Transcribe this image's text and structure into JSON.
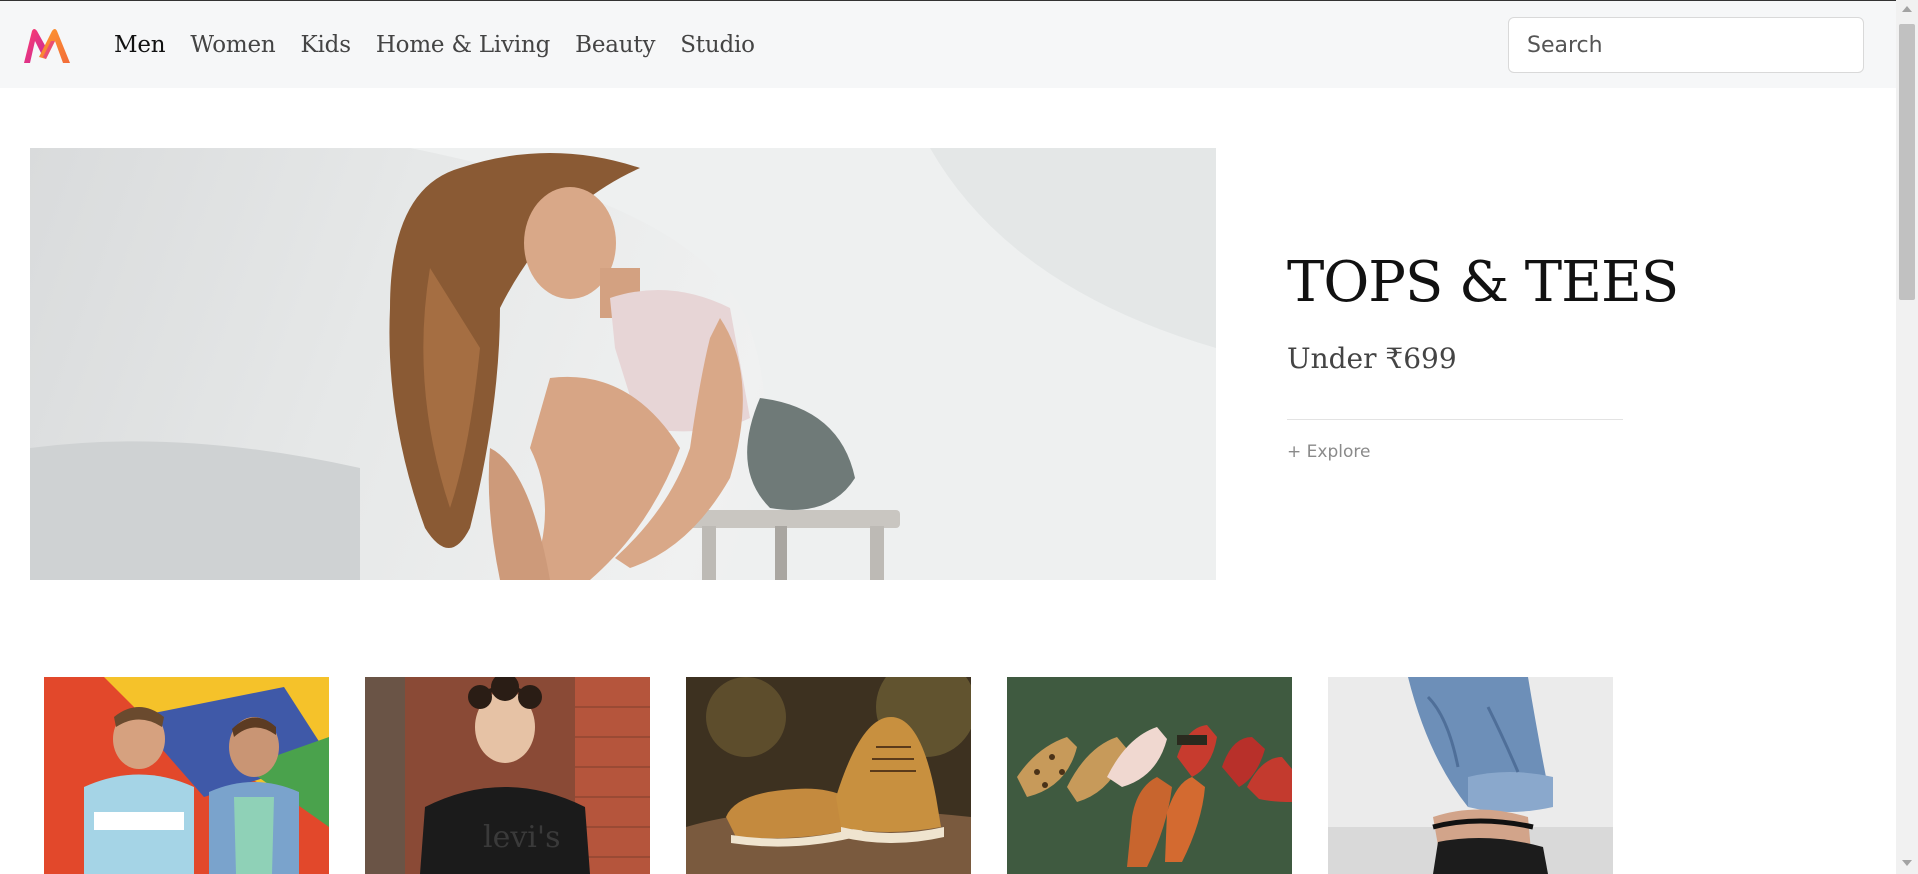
{
  "header": {
    "logo_icon": "myntra-m-logo",
    "nav": [
      {
        "label": "Men",
        "active": true
      },
      {
        "label": "Women",
        "active": false
      },
      {
        "label": "Kids",
        "active": false
      },
      {
        "label": "Home & Living",
        "active": false
      },
      {
        "label": "Beauty",
        "active": false
      },
      {
        "label": "Studio",
        "active": false
      }
    ],
    "search": {
      "placeholder": "Search",
      "value": ""
    }
  },
  "hero": {
    "image": "woman-sitting-on-stool-photo",
    "title": "TOPS & TEES",
    "subtitle": "Under ₹699",
    "cta": "+ Explore"
  },
  "tiles": [
    {
      "image": "two-men-in-shirts-photo"
    },
    {
      "image": "man-in-black-levis-tee-photo"
    },
    {
      "image": "tan-suede-shoes-photo"
    },
    {
      "image": "womens-mules-photo"
    },
    {
      "image": "jeans-and-black-heels-photo"
    }
  ],
  "colors": {
    "brand_pink": "#ff3f6c",
    "brand_orange": "#ff9a2e",
    "brand_purple": "#c6289c"
  }
}
